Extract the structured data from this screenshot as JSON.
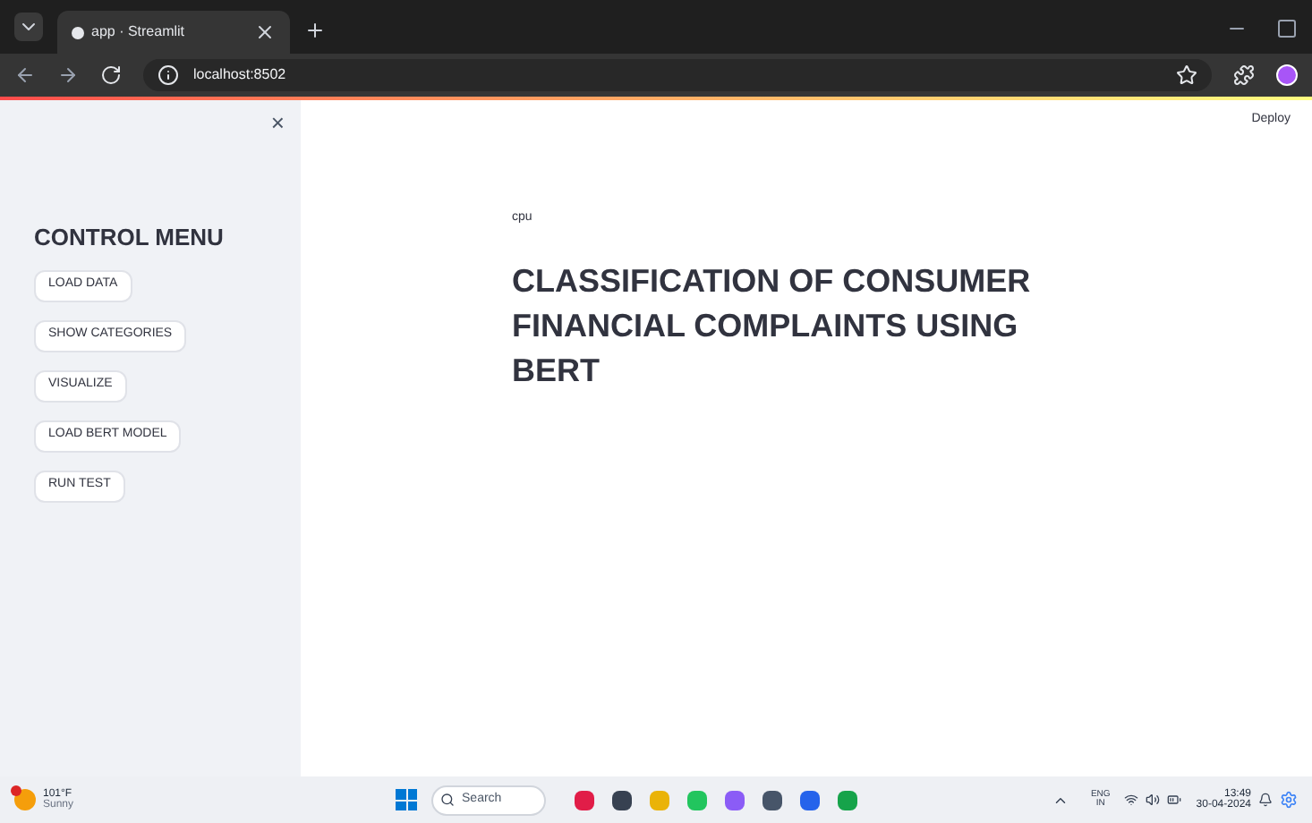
{
  "browser": {
    "tab_title": "app · Streamlit",
    "url": "localhost:8502"
  },
  "sidebar": {
    "heading": "CONTROL MENU",
    "close": "×",
    "buttons": [
      "LOAD DATA",
      "SHOW CATEGORIES",
      "VISUALIZE",
      "LOAD BERT MODEL",
      "RUN TEST"
    ]
  },
  "main": {
    "deploy": "Deploy",
    "device": "cpu",
    "title": "CLASSIFICATION OF CONSUMER FINANCIAL COMPLAINTS USING BERT"
  },
  "taskbar": {
    "temperature": "101°F",
    "condition": "Sunny",
    "search_placeholder": "Search",
    "language": "ENG",
    "region": "IN",
    "time": "13:49",
    "date": "30-04-2024"
  }
}
